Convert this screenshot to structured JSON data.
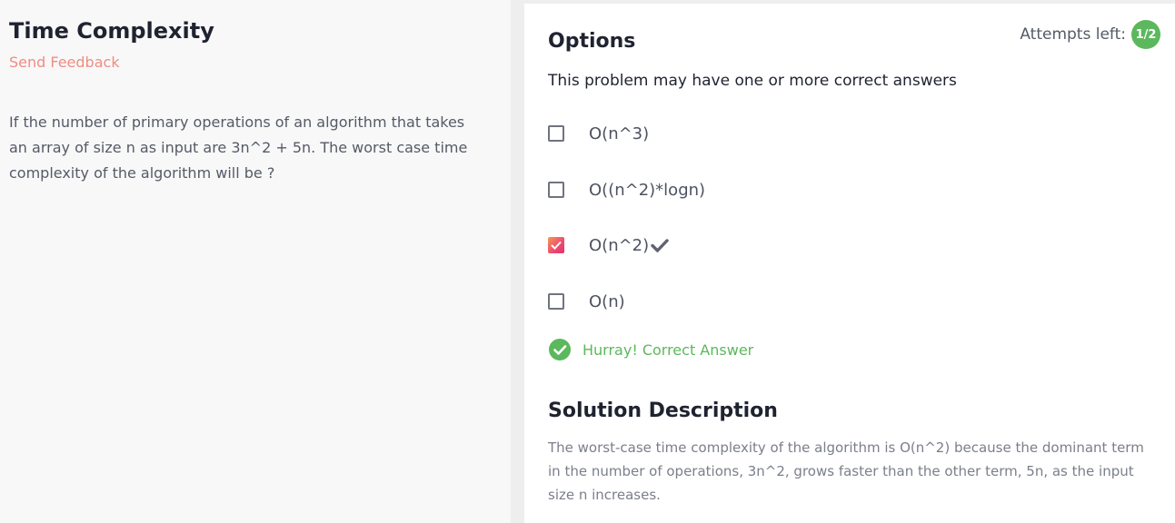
{
  "problem": {
    "title": "Time Complexity",
    "feedback_link": "Send Feedback",
    "question": "If the number of primary operations of an algorithm that takes an array of size n as input are 3n^2 + 5n. The worst case time complexity of the algorithm will be ?"
  },
  "options_panel": {
    "heading": "Options",
    "attempts_label": "Attempts left:",
    "attempts_value": "1/2",
    "subtitle": "This problem may have one or more correct answers",
    "options": [
      {
        "label": "O(n^3)",
        "checked": false
      },
      {
        "label": "O((n^2)*logn)",
        "checked": false
      },
      {
        "label": "O(n^2)",
        "checked": true,
        "correct": true
      },
      {
        "label": "O(n)",
        "checked": false
      }
    ],
    "result_text": "Hurray! Correct Answer"
  },
  "solution": {
    "heading": "Solution Description",
    "text": "The worst-case time complexity of the algorithm is O(n^2) because the dominant term in the number of operations, 3n^2, grows faster than the other term, 5n, as the input size n increases."
  },
  "colors": {
    "accent_green": "#5cb85c",
    "feedback_pink": "#f08c82",
    "checkbox_gradient_start": "#f59b53",
    "checkbox_gradient_end": "#e0306e"
  },
  "icons": {
    "check_mark": "check-icon",
    "result": "check-circle-icon"
  }
}
